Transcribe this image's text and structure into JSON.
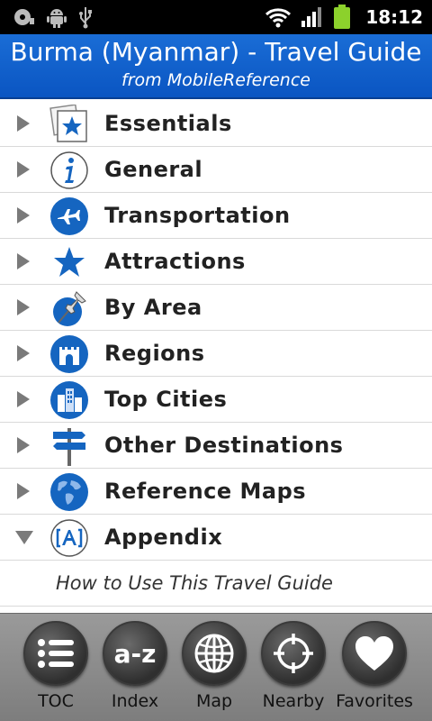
{
  "status_bar": {
    "time": "18:12",
    "left_icons": [
      "disc-icon",
      "android-icon",
      "usb-icon"
    ],
    "right_icons": [
      "wifi-icon",
      "signal-icon",
      "battery-icon"
    ],
    "battery_color": "#8cd12c"
  },
  "header": {
    "title": "Burma (Myanmar) - Travel Guide",
    "subtitle": "from MobileReference",
    "background_color": "#0a55c2"
  },
  "list": {
    "items": [
      {
        "label": "Essentials",
        "icon": "essentials-star-icon",
        "expanded": false
      },
      {
        "label": "General",
        "icon": "info-icon",
        "expanded": false
      },
      {
        "label": "Transportation",
        "icon": "airplane-icon",
        "expanded": false
      },
      {
        "label": "Attractions",
        "icon": "star-icon",
        "expanded": false
      },
      {
        "label": "By Area",
        "icon": "pushpin-icon",
        "expanded": false
      },
      {
        "label": "Regions",
        "icon": "castle-icon",
        "expanded": false
      },
      {
        "label": "Top Cities",
        "icon": "city-icon",
        "expanded": false
      },
      {
        "label": "Other Destinations",
        "icon": "signpost-icon",
        "expanded": false
      },
      {
        "label": "Reference Maps",
        "icon": "globe-icon",
        "expanded": false
      },
      {
        "label": "Appendix",
        "icon": "appendix-icon",
        "expanded": true
      }
    ],
    "subitems": [
      {
        "label": "How to Use This Travel Guide"
      }
    ]
  },
  "toolbar": {
    "buttons": [
      {
        "label": "TOC",
        "icon": "list-icon"
      },
      {
        "label": "Index",
        "icon": "az-icon",
        "glyph": "a-z"
      },
      {
        "label": "Map",
        "icon": "globe-grid-icon"
      },
      {
        "label": "Nearby",
        "icon": "crosshair-icon"
      },
      {
        "label": "Favorites",
        "icon": "heart-icon"
      }
    ]
  },
  "colors": {
    "accent_blue": "#1565c0",
    "row_divider": "#d9d9d9",
    "toolbar_bg": "#8a8a8a"
  }
}
